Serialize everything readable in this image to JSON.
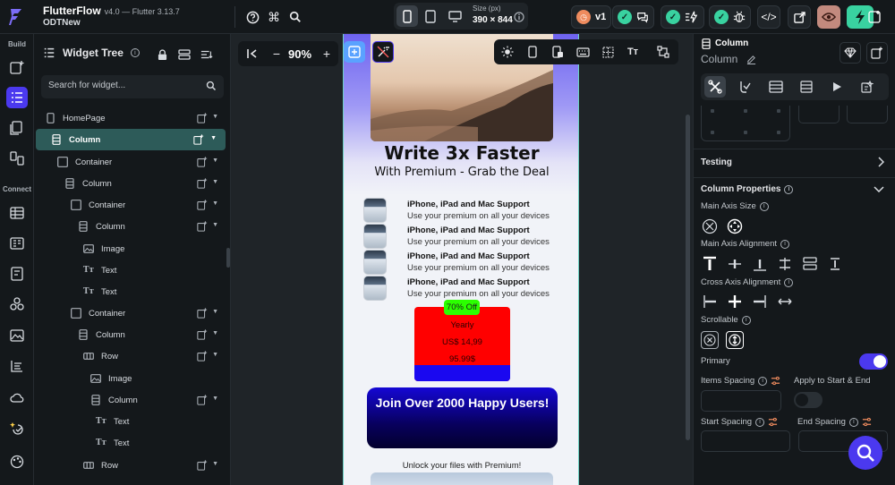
{
  "app": {
    "title": "FlutterFlow",
    "version": "v4.0 — Flutter 3.13.7",
    "project": "ODTNew"
  },
  "topbar": {
    "size_label": "Size (px)",
    "size_value": "390 × 844",
    "version_badge": "v1"
  },
  "rail": {
    "build_label": "Build",
    "connect_label": "Connect"
  },
  "tree": {
    "title": "Widget Tree",
    "search_placeholder": "Search for widget...",
    "rows": [
      {
        "label": "HomePage"
      },
      {
        "label": "Column"
      },
      {
        "label": "Container"
      },
      {
        "label": "Column"
      },
      {
        "label": "Container"
      },
      {
        "label": "Column"
      },
      {
        "label": "Image"
      },
      {
        "label": "Text"
      },
      {
        "label": "Text"
      },
      {
        "label": "Container"
      },
      {
        "label": "Column"
      },
      {
        "label": "Row"
      },
      {
        "label": "Image"
      },
      {
        "label": "Column"
      },
      {
        "label": "Text"
      },
      {
        "label": "Text"
      },
      {
        "label": "Row"
      }
    ]
  },
  "canvas": {
    "zoom": "90%"
  },
  "preview": {
    "title": "Write 3x Faster",
    "subtitle": "With Premium - Grab the Deal",
    "features": [
      {
        "title": "iPhone, iPad and Mac Support",
        "desc": "Use your premium on all your devices"
      },
      {
        "title": "iPhone, iPad and Mac Support",
        "desc": "Use your premium on all your devices"
      },
      {
        "title": "iPhone, iPad and Mac Support",
        "desc": "Use your premium on all your devices"
      },
      {
        "title": "iPhone, iPad and Mac Support",
        "desc": "Use your premium on all your devices"
      }
    ],
    "discount": "70% Off",
    "plan": "Yearly",
    "price": "US$ 14,99",
    "old_price": "95.99$",
    "join": "Join Over 2000 Happy Users!",
    "unlock": "Unlock your files with Premium!",
    "colors": {
      "card": "#ff0000",
      "badge": "#2bff00",
      "stripe": "#1a08f0",
      "accent": "#4b39ef"
    }
  },
  "props": {
    "widget_type": "Column",
    "widget_name": "Column",
    "testing": "Testing",
    "column_properties": "Column Properties",
    "main_axis_size": "Main Axis Size",
    "main_axis_alignment": "Main Axis Alignment",
    "cross_axis_alignment": "Cross Axis Alignment",
    "scrollable": "Scrollable",
    "primary": "Primary",
    "items_spacing": "Items Spacing",
    "apply_start_end": "Apply to Start & End",
    "start_spacing": "Start Spacing",
    "end_spacing": "End Spacing"
  }
}
